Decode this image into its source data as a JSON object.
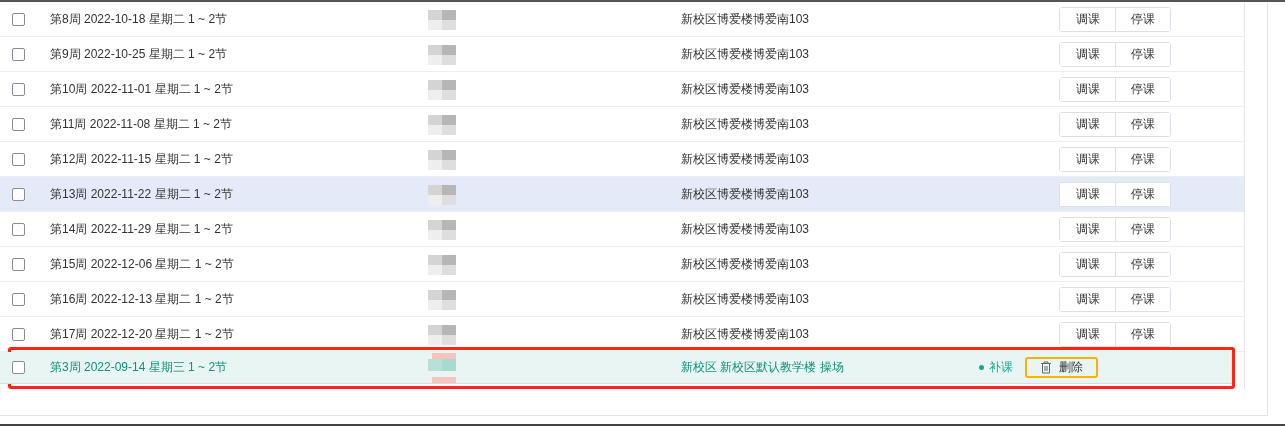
{
  "rows": [
    {
      "kind": "lesson",
      "checked": false,
      "hovered": false,
      "outlined": false,
      "time": "第8周 2022-10-18 星期二 1 ~ 2节",
      "location": "新校区博爱楼博爱南103",
      "actions": [
        {
          "label": "调课"
        },
        {
          "label": "停课"
        }
      ]
    },
    {
      "kind": "lesson",
      "checked": false,
      "hovered": false,
      "outlined": false,
      "time": "第9周 2022-10-25 星期二 1 ~ 2节",
      "location": "新校区博爱楼博爱南103",
      "actions": [
        {
          "label": "调课"
        },
        {
          "label": "停课"
        }
      ]
    },
    {
      "kind": "lesson",
      "checked": false,
      "hovered": false,
      "outlined": false,
      "time": "第10周 2022-11-01 星期二 1 ~ 2节",
      "location": "新校区博爱楼博爱南103",
      "actions": [
        {
          "label": "调课"
        },
        {
          "label": "停课"
        }
      ]
    },
    {
      "kind": "lesson",
      "checked": false,
      "hovered": false,
      "outlined": false,
      "time": "第11周 2022-11-08 星期二 1 ~ 2节",
      "location": "新校区博爱楼博爱南103",
      "actions": [
        {
          "label": "调课"
        },
        {
          "label": "停课"
        }
      ]
    },
    {
      "kind": "lesson",
      "checked": false,
      "hovered": false,
      "outlined": false,
      "time": "第12周 2022-11-15 星期二 1 ~ 2节",
      "location": "新校区博爱楼博爱南103",
      "actions": [
        {
          "label": "调课"
        },
        {
          "label": "停课"
        }
      ]
    },
    {
      "kind": "lesson",
      "checked": false,
      "hovered": true,
      "outlined": false,
      "time": "第13周 2022-11-22 星期二 1 ~ 2节",
      "location": "新校区博爱楼博爱南103",
      "actions": [
        {
          "label": "调课"
        },
        {
          "label": "停课"
        }
      ]
    },
    {
      "kind": "lesson",
      "checked": false,
      "hovered": false,
      "outlined": false,
      "time": "第14周 2022-11-29 星期二 1 ~ 2节",
      "location": "新校区博爱楼博爱南103",
      "actions": [
        {
          "label": "调课"
        },
        {
          "label": "停课"
        }
      ]
    },
    {
      "kind": "lesson",
      "checked": false,
      "hovered": false,
      "outlined": false,
      "time": "第15周 2022-12-06 星期二 1 ~ 2节",
      "location": "新校区博爱楼博爱南103",
      "actions": [
        {
          "label": "调课"
        },
        {
          "label": "停课"
        }
      ]
    },
    {
      "kind": "lesson",
      "checked": false,
      "hovered": false,
      "outlined": false,
      "time": "第16周 2022-12-13 星期二 1 ~ 2节",
      "location": "新校区博爱楼博爱南103",
      "actions": [
        {
          "label": "调课"
        },
        {
          "label": "停课"
        }
      ]
    },
    {
      "kind": "lesson",
      "checked": false,
      "hovered": false,
      "outlined": false,
      "time": "第17周 2022-12-20 星期二 1 ~ 2节",
      "location": "新校区博爱楼博爱南103",
      "actions": [
        {
          "label": "调课"
        },
        {
          "label": "停课"
        }
      ]
    },
    {
      "kind": "makeup",
      "checked": false,
      "hovered": false,
      "outlined": true,
      "time": "第3周 2022-09-14 星期三 1 ~ 2节",
      "location": "新校区 新校区默认教学楼 操场",
      "tag": "补课",
      "delete": {
        "label": "删除",
        "outlined": true
      }
    }
  ]
}
